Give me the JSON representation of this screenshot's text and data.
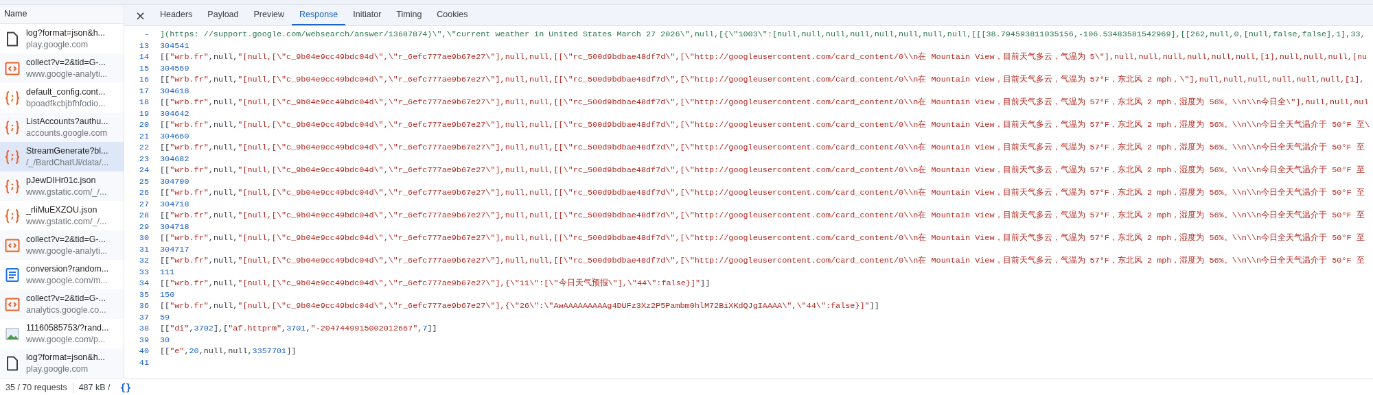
{
  "requests": {
    "column_header": "Name",
    "rows": [
      {
        "name": "log?format=json&h...",
        "host": "play.google.com",
        "kind": "doc",
        "selected": false
      },
      {
        "name": "collect?v=2&tid=G-...",
        "host": "www.google-analyti...",
        "kind": "script",
        "selected": false
      },
      {
        "name": "default_config.cont...",
        "host": "bpoadfkcbjbfhfodio...",
        "kind": "json",
        "selected": false
      },
      {
        "name": "ListAccounts?authu...",
        "host": "accounts.google.com",
        "kind": "json",
        "selected": false
      },
      {
        "name": "StreamGenerate?bl...",
        "host": "/_/BardChatUi/data/...",
        "kind": "json",
        "selected": true
      },
      {
        "name": "pJewDIHr01c.json",
        "host": "www.gstatic.com/_/...",
        "kind": "json",
        "selected": false
      },
      {
        "name": "_rliMuEXZOU.json",
        "host": "www.gstatic.com/_/...",
        "kind": "json",
        "selected": false
      },
      {
        "name": "collect?v=2&tid=G-...",
        "host": "www.google-analyti...",
        "kind": "script",
        "selected": false
      },
      {
        "name": "conversion?random...",
        "host": "www.google.com/m...",
        "kind": "document",
        "selected": false
      },
      {
        "name": "collect?v=2&tid=G-...",
        "host": "analytics.google.co...",
        "kind": "script",
        "selected": false
      },
      {
        "name": "11160585753/?rand...",
        "host": "www.google.com/p...",
        "kind": "image",
        "selected": false
      },
      {
        "name": "log?format=json&h...",
        "host": "play.google.com",
        "kind": "doc",
        "selected": false
      }
    ]
  },
  "tabs": [
    {
      "label": "Headers",
      "selected": false
    },
    {
      "label": "Payload",
      "selected": false
    },
    {
      "label": "Preview",
      "selected": false
    },
    {
      "label": "Response",
      "selected": true
    },
    {
      "label": "Initiator",
      "selected": false
    },
    {
      "label": "Timing",
      "selected": false
    },
    {
      "label": "Cookies",
      "selected": false
    }
  ],
  "close_icon": "×",
  "response_lines": [
    {
      "number": "-",
      "tokens": [
        {
          "kind": "green",
          "text": "](https: //support.google.com/websearch/answer/13687874)\\\",\\\"current weather in United States March 27 2026\\\",null,[{\\\"1003\\\":[null,null,null,null,null,null,null,null,[[[38.794593811035156,-106.53483581542969],[[262,null,0,[null,false,false],1],33,"
        }
      ]
    },
    {
      "number": "13",
      "tokens": [
        {
          "kind": "num",
          "text": "304541"
        }
      ]
    },
    {
      "number": "14",
      "tokens": [
        {
          "kind": "punc",
          "text": "[["
        },
        {
          "kind": "str",
          "text": "\"wrb.fr\""
        },
        {
          "kind": "punc",
          "text": ",null,"
        },
        {
          "kind": "str",
          "text": "\"[null,[\\\"c_9b04e9cc49bdc04d\\\",\\\"r_6efc777ae9b67e27\\\"],null,null,[[\\\"rc_500d9bdbae48df7d\\\",[\\\"http://googleusercontent.com/card_content/0\\\\n在 Mountain View，目前天气多云，气温为 5\\\"],null,null,null,null,null,null,[1],null,null,null,[nu"
        }
      ]
    },
    {
      "number": "15",
      "tokens": [
        {
          "kind": "num",
          "text": "304569"
        }
      ]
    },
    {
      "number": "16",
      "tokens": [
        {
          "kind": "punc",
          "text": "[["
        },
        {
          "kind": "str",
          "text": "\"wrb.fr\""
        },
        {
          "kind": "punc",
          "text": ",null,"
        },
        {
          "kind": "str",
          "text": "\"[null,[\\\"c_9b04e9cc49bdc04d\\\",\\\"r_6efc777ae9b67e27\\\"],null,null,[[\\\"rc_500d9bdbae48df7d\\\",[\\\"http://googleusercontent.com/card_content/0\\\\n在 Mountain View，目前天气多云，气温为 57°F，东北风 2 mph，\\\"],null,null,null,null,null,null,[1],"
        }
      ]
    },
    {
      "number": "17",
      "tokens": [
        {
          "kind": "num",
          "text": "304618"
        }
      ]
    },
    {
      "number": "18",
      "tokens": [
        {
          "kind": "punc",
          "text": "[["
        },
        {
          "kind": "str",
          "text": "\"wrb.fr\""
        },
        {
          "kind": "punc",
          "text": ",null,"
        },
        {
          "kind": "str",
          "text": "\"[null,[\\\"c_9b04e9cc49bdc04d\\\",\\\"r_6efc777ae9b67e27\\\"],null,null,[[\\\"rc_500d9bdbae48df7d\\\",[\\\"http://googleusercontent.com/card_content/0\\\\n在 Mountain View，目前天气多云，气温为 57°F，东北风 2 mph，湿度为 56%。\\\\n\\\\n今日全\\\"],null,null,nul"
        }
      ]
    },
    {
      "number": "19",
      "tokens": [
        {
          "kind": "num",
          "text": "304642"
        }
      ]
    },
    {
      "number": "20",
      "tokens": [
        {
          "kind": "punc",
          "text": "[["
        },
        {
          "kind": "str",
          "text": "\"wrb.fr\""
        },
        {
          "kind": "punc",
          "text": ",null,"
        },
        {
          "kind": "str",
          "text": "\"[null,[\\\"c_9b04e9cc49bdc04d\\\",\\\"r_6efc777ae9b67e27\\\"],null,null,[[\\\"rc_500d9bdbae48df7d\\\",[\\\"http://googleusercontent.com/card_content/0\\\\n在 Mountain View，目前天气多云，气温为 57°F，东北风 2 mph，湿度为 56%。\\\\n\\\\n今日全天气温介于 50°F 至\\"
        }
      ]
    },
    {
      "number": "21",
      "tokens": [
        {
          "kind": "num",
          "text": "304660"
        }
      ]
    },
    {
      "number": "22",
      "tokens": [
        {
          "kind": "punc",
          "text": "[["
        },
        {
          "kind": "str",
          "text": "\"wrb.fr\""
        },
        {
          "kind": "punc",
          "text": ",null,"
        },
        {
          "kind": "str",
          "text": "\"[null,[\\\"c_9b04e9cc49bdc04d\\\",\\\"r_6efc777ae9b67e27\\\"],null,null,[[\\\"rc_500d9bdbae48df7d\\\",[\\\"http://googleusercontent.com/card_content/0\\\\n在 Mountain View，目前天气多云，气温为 57°F，东北风 2 mph，湿度为 56%。\\\\n\\\\n今日全天气温介于 50°F 至"
        }
      ]
    },
    {
      "number": "23",
      "tokens": [
        {
          "kind": "num",
          "text": "304682"
        }
      ]
    },
    {
      "number": "24",
      "tokens": [
        {
          "kind": "punc",
          "text": "[["
        },
        {
          "kind": "str",
          "text": "\"wrb.fr\""
        },
        {
          "kind": "punc",
          "text": ",null,"
        },
        {
          "kind": "str",
          "text": "\"[null,[\\\"c_9b04e9cc49bdc04d\\\",\\\"r_6efc777ae9b67e27\\\"],null,null,[[\\\"rc_500d9bdbae48df7d\\\",[\\\"http://googleusercontent.com/card_content/0\\\\n在 Mountain View，目前天气多云，气温为 57°F，东北风 2 mph，湿度为 56%。\\\\n\\\\n今日全天气温介于 50°F 至"
        }
      ]
    },
    {
      "number": "25",
      "tokens": [
        {
          "kind": "num",
          "text": "304700"
        }
      ]
    },
    {
      "number": "26",
      "tokens": [
        {
          "kind": "punc",
          "text": "[["
        },
        {
          "kind": "str",
          "text": "\"wrb.fr\""
        },
        {
          "kind": "punc",
          "text": ",null,"
        },
        {
          "kind": "str",
          "text": "\"[null,[\\\"c_9b04e9cc49bdc04d\\\",\\\"r_6efc777ae9b67e27\\\"],null,null,[[\\\"rc_500d9bdbae48df7d\\\",[\\\"http://googleusercontent.com/card_content/0\\\\n在 Mountain View，目前天气多云，气温为 57°F，东北风 2 mph，湿度为 56%。\\\\n\\\\n今日全天气温介于 50°F 至"
        }
      ]
    },
    {
      "number": "27",
      "tokens": [
        {
          "kind": "num",
          "text": "304718"
        }
      ]
    },
    {
      "number": "28",
      "tokens": [
        {
          "kind": "punc",
          "text": "[["
        },
        {
          "kind": "str",
          "text": "\"wrb.fr\""
        },
        {
          "kind": "punc",
          "text": ",null,"
        },
        {
          "kind": "str",
          "text": "\"[null,[\\\"c_9b04e9cc49bdc04d\\\",\\\"r_6efc777ae9b67e27\\\"],null,null,[[\\\"rc_500d9bdbae48df7d\\\",[\\\"http://googleusercontent.com/card_content/0\\\\n在 Mountain View，目前天气多云，气温为 57°F，东北风 2 mph，湿度为 56%。\\\\n\\\\n今日全天气温介于 50°F 至"
        }
      ]
    },
    {
      "number": "29",
      "tokens": [
        {
          "kind": "num",
          "text": "304718"
        }
      ]
    },
    {
      "number": "30",
      "tokens": [
        {
          "kind": "punc",
          "text": "[["
        },
        {
          "kind": "str",
          "text": "\"wrb.fr\""
        },
        {
          "kind": "punc",
          "text": ",null,"
        },
        {
          "kind": "str",
          "text": "\"[null,[\\\"c_9b04e9cc49bdc04d\\\",\\\"r_6efc777ae9b67e27\\\"],null,null,[[\\\"rc_500d9bdbae48df7d\\\",[\\\"http://googleusercontent.com/card_content/0\\\\n在 Mountain View，目前天气多云，气温为 57°F，东北风 2 mph，湿度为 56%。\\\\n\\\\n今日全天气温介于 50°F 至"
        }
      ]
    },
    {
      "number": "31",
      "tokens": [
        {
          "kind": "num",
          "text": "304717"
        }
      ]
    },
    {
      "number": "32",
      "tokens": [
        {
          "kind": "punc",
          "text": "[["
        },
        {
          "kind": "str",
          "text": "\"wrb.fr\""
        },
        {
          "kind": "punc",
          "text": ",null,"
        },
        {
          "kind": "str",
          "text": "\"[null,[\\\"c_9b04e9cc49bdc04d\\\",\\\"r_6efc777ae9b67e27\\\"],null,null,[[\\\"rc_500d9bdbae48df7d\\\",[\\\"http://googleusercontent.com/card_content/0\\\\n在 Mountain View，目前天气多云，气温为 57°F，东北风 2 mph，湿度为 56%。\\\\n\\\\n今日全天气温介于 50°F 至"
        }
      ]
    },
    {
      "number": "33",
      "tokens": [
        {
          "kind": "num",
          "text": "111"
        }
      ]
    },
    {
      "number": "34",
      "tokens": [
        {
          "kind": "punc",
          "text": "[["
        },
        {
          "kind": "str",
          "text": "\"wrb.fr\""
        },
        {
          "kind": "punc",
          "text": ",null,"
        },
        {
          "kind": "str",
          "text": "\"[null,[\\\"c_9b04e9cc49bdc04d\\\",\\\"r_6efc777ae9b67e27\\\"],{\\\"11\\\":[\\\"今日天气预报\\\"],\\\"44\\\":false}]\""
        },
        {
          "kind": "punc",
          "text": "]]"
        }
      ]
    },
    {
      "number": "35",
      "tokens": [
        {
          "kind": "num",
          "text": "150"
        }
      ]
    },
    {
      "number": "36",
      "tokens": [
        {
          "kind": "punc",
          "text": "[["
        },
        {
          "kind": "str",
          "text": "\"wrb.fr\""
        },
        {
          "kind": "punc",
          "text": ",null,"
        },
        {
          "kind": "str",
          "text": "\"[null,[\\\"c_9b04e9cc49bdc04d\\\",\\\"r_6efc777ae9b67e27\\\"],{\\\"26\\\":\\\"AwAAAAAAAAAg4DUFz3Xz2P5Pambm0hlM72BiXKdQJgIAAAA\\\",\\\"44\\\":false}]\""
        },
        {
          "kind": "punc",
          "text": "]]"
        }
      ]
    },
    {
      "number": "37",
      "tokens": [
        {
          "kind": "num",
          "text": "59"
        }
      ]
    },
    {
      "number": "38",
      "tokens": [
        {
          "kind": "punc",
          "text": "[["
        },
        {
          "kind": "str",
          "text": "\"di\""
        },
        {
          "kind": "punc",
          "text": ","
        },
        {
          "kind": "num",
          "text": "3702"
        },
        {
          "kind": "punc",
          "text": "],["
        },
        {
          "kind": "str",
          "text": "\"af.httprm\""
        },
        {
          "kind": "punc",
          "text": ","
        },
        {
          "kind": "num",
          "text": "3701"
        },
        {
          "kind": "punc",
          "text": ","
        },
        {
          "kind": "str",
          "text": "\"-2047449915002012667\""
        },
        {
          "kind": "punc",
          "text": ","
        },
        {
          "kind": "num",
          "text": "7"
        },
        {
          "kind": "punc",
          "text": "]]"
        }
      ]
    },
    {
      "number": "39",
      "tokens": [
        {
          "kind": "num",
          "text": "30"
        }
      ]
    },
    {
      "number": "40",
      "tokens": [
        {
          "kind": "punc",
          "text": "[["
        },
        {
          "kind": "str",
          "text": "\"e\""
        },
        {
          "kind": "punc",
          "text": ","
        },
        {
          "kind": "num",
          "text": "20"
        },
        {
          "kind": "punc",
          "text": ",null,null,"
        },
        {
          "kind": "num",
          "text": "3357701"
        },
        {
          "kind": "punc",
          "text": "]]"
        }
      ]
    },
    {
      "number": "41"
    }
  ],
  "status_bar": {
    "requests": "35 / 70 requests",
    "size": "487 kB /",
    "pretty_print": "{}"
  }
}
